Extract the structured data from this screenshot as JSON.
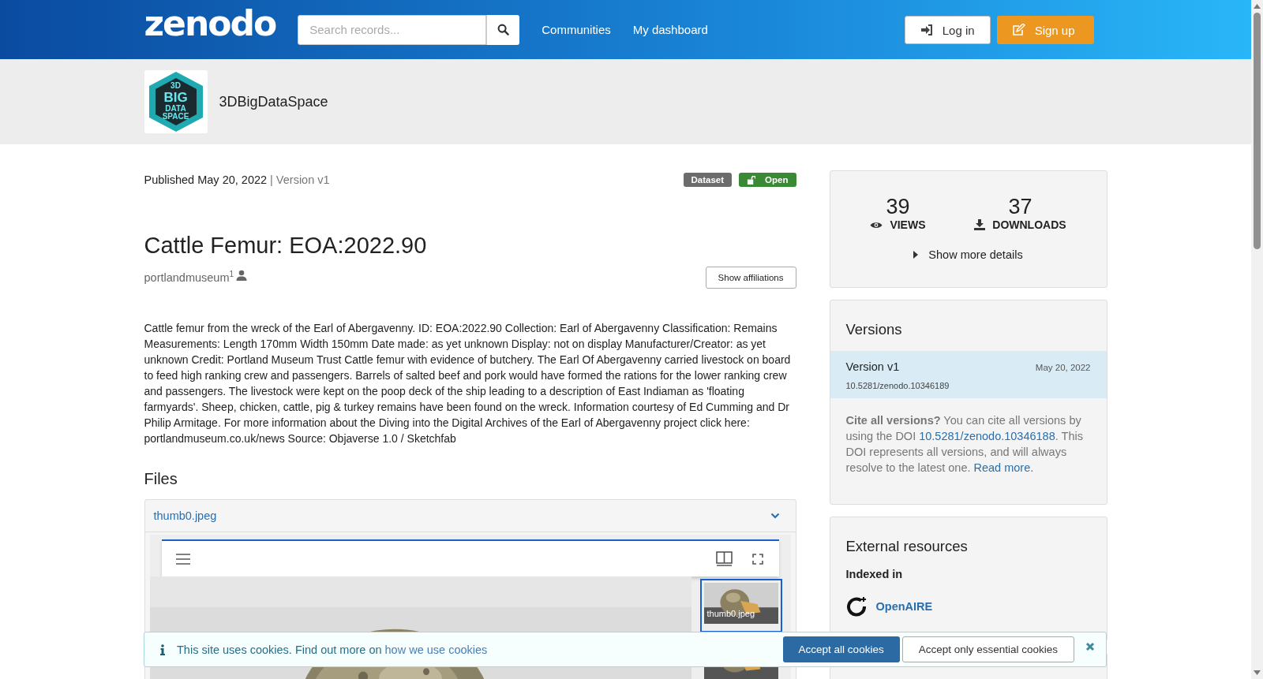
{
  "header": {
    "logo": "zenodo",
    "search": {
      "placeholder": "Search records..."
    },
    "nav": [
      "Communities",
      "My dashboard"
    ],
    "buttons": [
      {
        "kind": "login",
        "label": "Log in"
      },
      {
        "kind": "signup",
        "label": "Sign up"
      }
    ]
  },
  "community": {
    "logo_lines": [
      "3D",
      "BIG",
      "DATA",
      "SPACE"
    ],
    "name": "3DBigDataSpace"
  },
  "record": {
    "published": "Published May 20, 2022",
    "version": "| Version v1",
    "badges": [
      {
        "kind": "type",
        "label": "Dataset",
        "color": "#6c6c6c"
      },
      {
        "kind": "access",
        "label": "Open",
        "color": "#3a8a35"
      }
    ],
    "title": "Cattle Femur: EOA:2022.90",
    "creator": "portlandmuseum",
    "creator_sup": "1",
    "affiliations_button": "Show affiliations",
    "description": "Cattle femur from the wreck of the Earl of Abergavenny. ID: EOA:2022.90 Collection: Earl of Abergavenny Classification: Remains Measurements: Length 170mm Width 150mm Date made: as yet unknown Display: not on display Manufacturer/Creator: as yet unknown Credit: Portland Museum Trust Cattle femur with evidence of butchery. The Earl Of Abergavenny carried livestock on board to feed high ranking crew and passengers. Barrels of salted beef and pork would have formed the rations for the lower ranking crew and passengers. The livestock were kept on the poop deck of the ship leading to a description of East Indiaman as 'floating farmyards'. Sheep, chicken, cattle, pig & turkey remains have been found on the wreck. Information courtesy of Ed Cumming and Dr Philip Armitage. For more information about the Diving into the Digital Archives of the Earl of Abergavenny project click here: portlandmuseum.co.uk/news Source: Objaverse 1.0 / Sketchfab"
  },
  "files": {
    "heading": "Files",
    "file_name": "thumb0.jpeg",
    "expanded": true,
    "thumbnails": [
      {
        "label": "thumb0.jpeg",
        "selected": true
      },
      {
        "selected": false
      }
    ]
  },
  "stats": [
    {
      "kind": "views",
      "value": "39",
      "label": "VIEWS"
    },
    {
      "kind": "downloads",
      "value": "37",
      "label": "DOWNLOADS"
    }
  ],
  "more_details": "Show more details",
  "versions": {
    "heading": "Versions",
    "items": [
      {
        "name": "Version v1",
        "date": "May 20, 2022",
        "doi": "10.5281/zenodo.10346189",
        "selected": true
      }
    ],
    "cite_lead": "Cite all versions?",
    "cite_text1": "You can cite all versions by using the DOI",
    "cite_doi": "10.5281/zenodo.10346188",
    "cite_text2": ". This DOI represents all versions, and will always resolve to the latest one.",
    "read_more": "Read more."
  },
  "external": {
    "heading": "External resources",
    "subheading": "Indexed in",
    "items": [
      "OpenAIRE"
    ]
  },
  "cookies": {
    "text": "This site uses cookies. Find out more on",
    "link": "how we use cookies",
    "accept_all": "Accept all cookies",
    "accept_essential": "Accept only essential cookies"
  }
}
